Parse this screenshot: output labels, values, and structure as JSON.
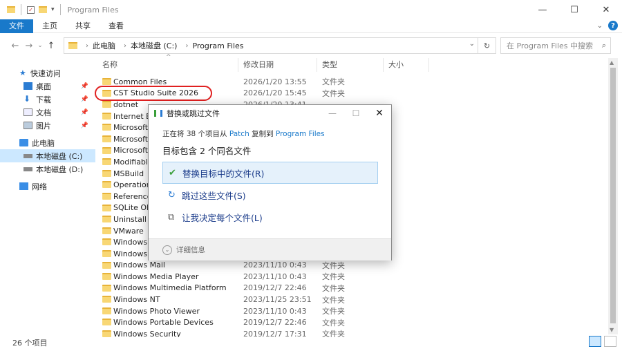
{
  "window": {
    "title": "Program Files"
  },
  "ribbon": {
    "tabs": [
      "文件",
      "主页",
      "共享",
      "查看"
    ]
  },
  "address": {
    "crumbs": [
      "此电脑",
      "本地磁盘 (C:)",
      "Program Files"
    ]
  },
  "search": {
    "placeholder": "在 Program Files 中搜索"
  },
  "nav": {
    "items": [
      {
        "label": "快速访问"
      },
      {
        "label": "桌面"
      },
      {
        "label": "下载"
      },
      {
        "label": "文档"
      },
      {
        "label": "图片"
      },
      {
        "label": "此电脑"
      },
      {
        "label": "本地磁盘 (C:)"
      },
      {
        "label": "本地磁盘 (D:)"
      },
      {
        "label": "网络"
      }
    ]
  },
  "columns": {
    "name": "名称",
    "date": "修改日期",
    "type": "类型",
    "size": "大小"
  },
  "files": [
    {
      "name": "Common Files",
      "date": "2026/1/20 13:55",
      "type": "文件夹"
    },
    {
      "name": "CST Studio Suite 2026",
      "date": "2026/1/20 15:45",
      "type": "文件夹"
    },
    {
      "name": "dotnet",
      "date": "2026/1/20 13:41",
      "type": ""
    },
    {
      "name": "Internet Ex",
      "date": "",
      "type": ""
    },
    {
      "name": "Microsoft",
      "date": "",
      "type": ""
    },
    {
      "name": "Microsoft",
      "date": "",
      "type": ""
    },
    {
      "name": "Microsoft S",
      "date": "",
      "type": ""
    },
    {
      "name": "Modifiable",
      "date": "",
      "type": ""
    },
    {
      "name": "MSBuild",
      "date": "",
      "type": ""
    },
    {
      "name": "Operation",
      "date": "",
      "type": ""
    },
    {
      "name": "Reference",
      "date": "",
      "type": ""
    },
    {
      "name": "SQLite ODE",
      "date": "",
      "type": ""
    },
    {
      "name": "Uninstall In",
      "date": "",
      "type": ""
    },
    {
      "name": "VMware",
      "date": "",
      "type": ""
    },
    {
      "name": "Windows D",
      "date": "",
      "type": ""
    },
    {
      "name": "Windows D",
      "date": "",
      "type": ""
    },
    {
      "name": "Windows Mail",
      "date": "2023/11/10 0:43",
      "type": "文件夹"
    },
    {
      "name": "Windows Media Player",
      "date": "2023/11/10 0:43",
      "type": "文件夹"
    },
    {
      "name": "Windows Multimedia Platform",
      "date": "2019/12/7 22:46",
      "type": "文件夹"
    },
    {
      "name": "Windows NT",
      "date": "2023/11/25 23:51",
      "type": "文件夹"
    },
    {
      "name": "Windows Photo Viewer",
      "date": "2023/11/10 0:43",
      "type": "文件夹"
    },
    {
      "name": "Windows Portable Devices",
      "date": "2019/12/7 22:46",
      "type": "文件夹"
    },
    {
      "name": "Windows Security",
      "date": "2019/12/7 17:31",
      "type": "文件夹"
    }
  ],
  "status": {
    "count": "26 个项目"
  },
  "dialog": {
    "title": "替换或跳过文件",
    "line1_prefix": "正在将 38 个项目从",
    "source": "Patch",
    "line1_mid": "复制到",
    "dest": "Program Files",
    "line2": "目标包含 2 个同名文件",
    "options": [
      {
        "label": "替换目标中的文件(R)",
        "icon": "check-icon"
      },
      {
        "label": "跳过这些文件(S)",
        "icon": "skip-icon"
      },
      {
        "label": "让我决定每个文件(L)",
        "icon": "decide-icon"
      }
    ],
    "details": "详细信息"
  }
}
